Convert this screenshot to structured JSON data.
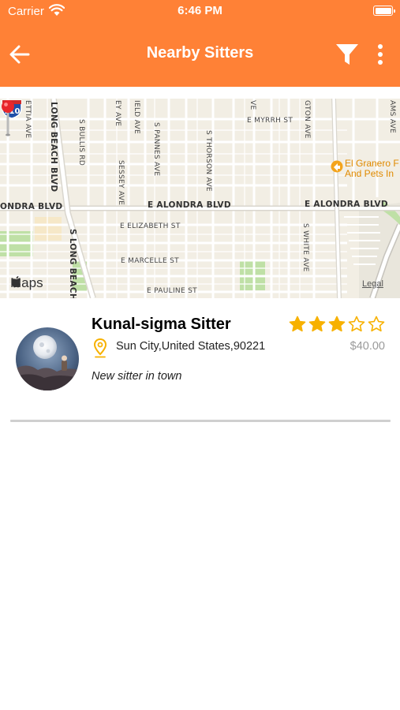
{
  "status_bar": {
    "carrier": "Carrier",
    "time": "6:46 PM"
  },
  "header": {
    "title": "Nearby Sitters",
    "back_icon": "back-arrow-icon",
    "filter_icon": "filter-icon",
    "more_icon": "more-vertical-icon"
  },
  "map": {
    "streets": {
      "ettia": "ETTIA AVE",
      "long_beach_blvd": "LONG BEACH BLVD",
      "s_bullis": "S BULLIS RD",
      "ey_ave": "EY AVE",
      "sessey": "SESSEY AVE",
      "ield": "IELD AVE",
      "s_pannes": "S PANNES AVE",
      "s_thorson": "S THORSON AVE",
      "ve": "VE",
      "gton": "GTON AVE",
      "ams": "AMS AVE",
      "myrrh": "E MYRRH ST",
      "ondra_left": "ONDRA BLVD",
      "alondra_1": "E ALONDRA BLVD",
      "alondra_2": "E ALONDRA BLVD",
      "elizabeth": "E ELIZABETH ST",
      "marcelle": "E MARCELLE ST",
      "pauline": "E PAULINE ST",
      "s_long_beach": "S LONG BEACH",
      "s_white": "S WHITE AVE"
    },
    "poi_line1": "El Granero F",
    "poi_line2": "And Pets In",
    "highway_shield": "710",
    "maps_logo": "Maps",
    "legal": "Legal"
  },
  "sitter": {
    "name": "Kunal-sigma Sitter",
    "address": "Sun City,United States,90221",
    "price": "$40.00",
    "tagline": "New sitter in town",
    "rating": 3,
    "rating_max": 5
  },
  "colors": {
    "accent": "#FF8136",
    "star": "#F7B100",
    "pin": "#E8262B"
  }
}
